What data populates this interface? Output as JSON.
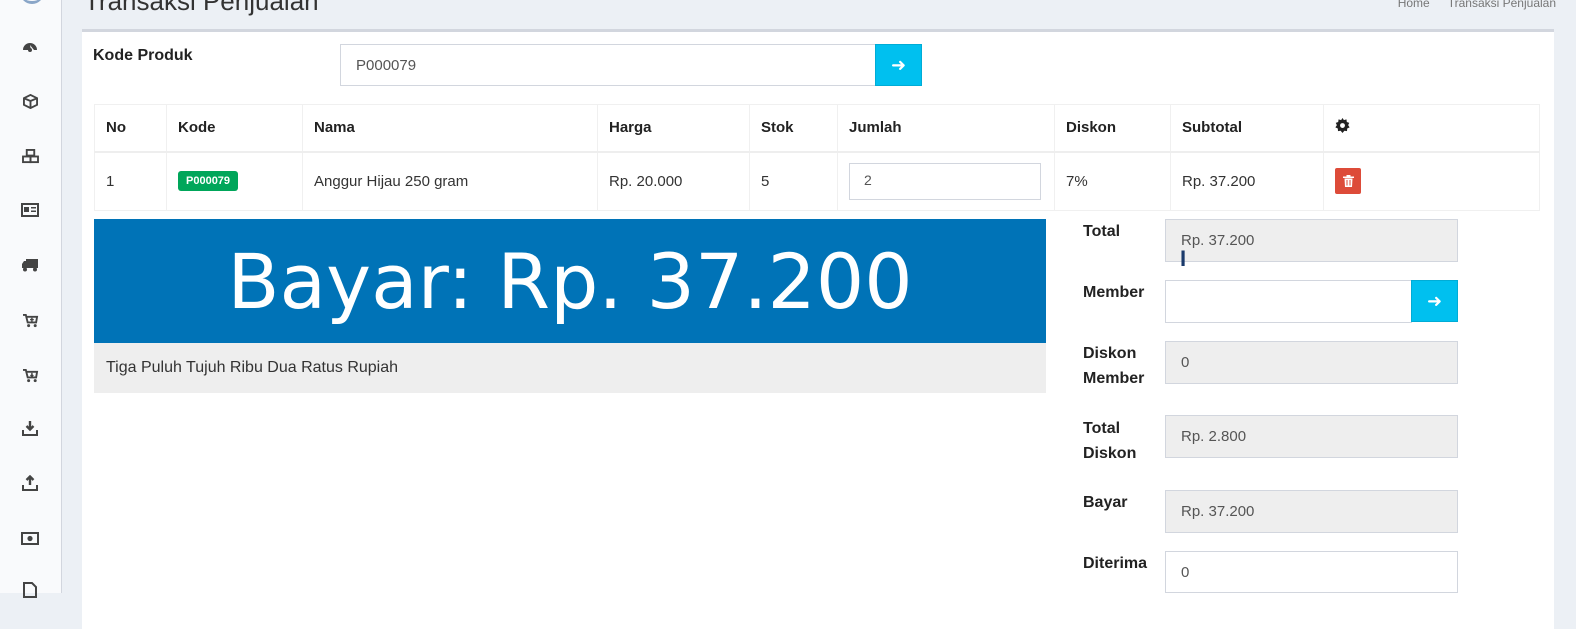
{
  "header": {
    "title": "Transaksi Penjualan",
    "breadcrumb": [
      "Home",
      "Transaksi Penjualan"
    ]
  },
  "sidebar": {
    "icons": [
      "dashboard-icon",
      "cube-icon",
      "cubes-icon",
      "id-card-icon",
      "truck-icon",
      "cart-plus-icon",
      "cart-arrow-icon",
      "download-icon",
      "upload-icon",
      "money-icon",
      "file-icon"
    ]
  },
  "form": {
    "kode_produk_label": "Kode Produk",
    "kode_produk_value": "P000079",
    "go_icon": "arrow-right-icon"
  },
  "table": {
    "columns": [
      "No",
      "Kode",
      "Nama",
      "Harga",
      "Stok",
      "Jumlah",
      "Diskon",
      "Subtotal"
    ],
    "settings_icon": "gear-icon",
    "rows": [
      {
        "no": "1",
        "kode": "P000079",
        "nama": "Anggur Hijau 250 gram",
        "harga": "Rp. 20.000",
        "stok": "5",
        "jumlah": "2",
        "diskon": "7%",
        "subtotal": "Rp. 37.200"
      }
    ]
  },
  "summary": {
    "bayar_display": "Bayar: Rp. 37.200",
    "terbilang": "Tiga Puluh Tujuh Ribu Dua Ratus Rupiah",
    "accent": "#0073b7",
    "total_label": "Total",
    "total_value": "Rp. 37.200",
    "member_label": "Member",
    "member_value": "",
    "diskon_member_label_1": "Diskon",
    "diskon_member_label_2": "Member",
    "diskon_member_value": "0",
    "total_diskon_label_1": "Total",
    "total_diskon_label_2": "Diskon",
    "total_diskon_value": "Rp. 2.800",
    "bayar_label": "Bayar",
    "bayar_value": "Rp. 37.200",
    "diterima_label": "Diterima",
    "diterima_value": "0"
  }
}
